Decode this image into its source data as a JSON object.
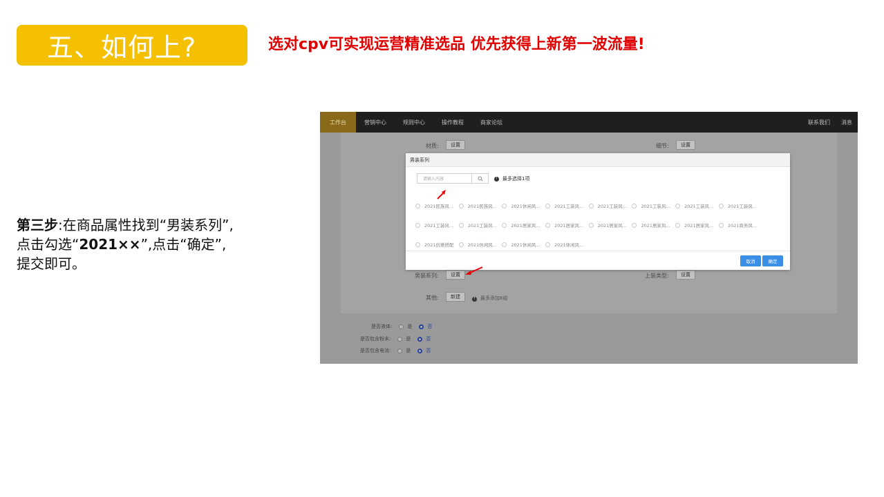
{
  "slide": {
    "title": "五、如何上?",
    "subtitle": "选对cpv可实现运营精准选品 优先获得上新第一波流量!",
    "step": {
      "bold_prefix": "第三步",
      "line1_rest": ":在商品属性找到“男装系列”,",
      "line2_pre": "点击勾选“",
      "line2_bold": "2021××",
      "line2_post": "”,点击“确定”,",
      "line3": "提交即可。"
    },
    "colors": {
      "title_bg": "#f5c000",
      "subtitle": "#e00000",
      "arrow": "#e60000"
    }
  },
  "screenshot": {
    "nav": {
      "items": [
        "工作台",
        "营销中心",
        "规则中心",
        "操作教程",
        "商家论坛"
      ],
      "right": [
        "联系我们",
        "消息"
      ]
    },
    "form": {
      "material_label": "材质:",
      "detail_label": "细节:",
      "set_label": "设置",
      "series_label": "男装系列:",
      "top_type_label": "上装类型:",
      "other_label": "其他:",
      "new_label": "新建",
      "max_add_hint": "最多添加8组",
      "liquid_label": "是否液体:",
      "powder_label": "是否包含粉末:",
      "battery_label": "是否包含电池:",
      "yes": "是",
      "no": "否"
    },
    "modal": {
      "title": "男装系列",
      "search_placeholder": "请输入内容",
      "search_icon": "search-icon",
      "limit_note": "最多选择1项",
      "options": [
        [
          "2021民族风...",
          "2021民族风...",
          "2021休闲风...",
          "2021工装风...",
          "2021工装风...",
          "2021工装风...",
          "2021工装风...",
          "2021工装风..."
        ],
        [
          "2021工装风...",
          "2021工装风...",
          "2021居家风...",
          "2021居家风...",
          "2021居家风...",
          "2021居家风...",
          "2021居家风...",
          "2021商务风..."
        ],
        [
          "2021创意搭配",
          "2021休闲风...",
          "2021休闲风...",
          "2021休闲风..."
        ]
      ],
      "cancel_label": "取消",
      "ok_label": "确定"
    }
  }
}
